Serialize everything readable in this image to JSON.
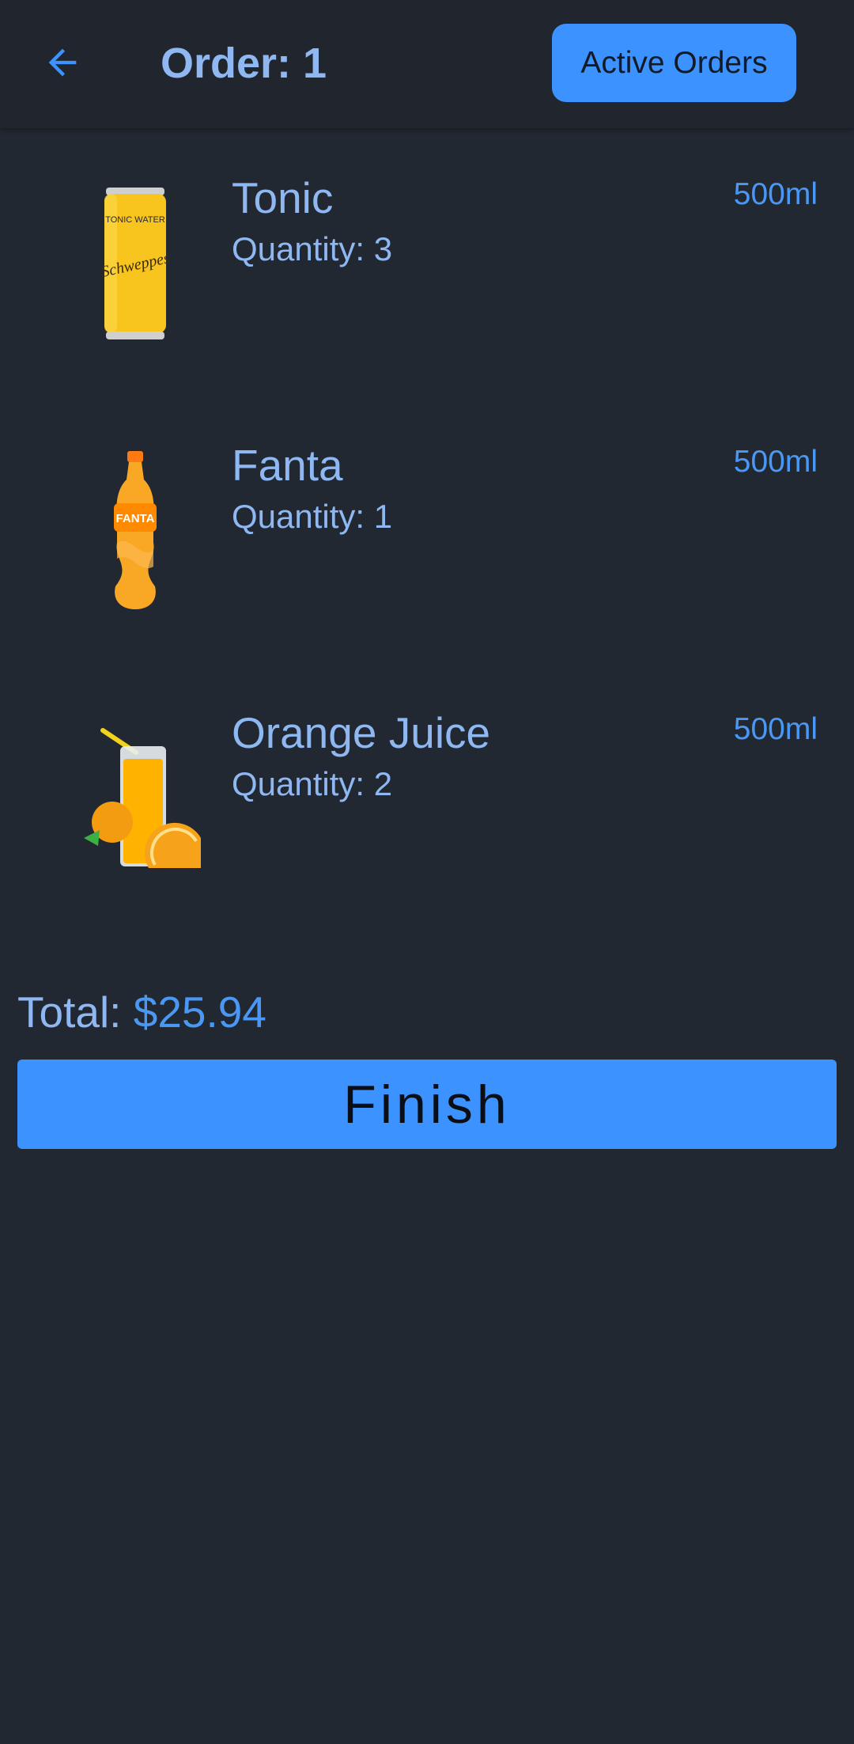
{
  "header": {
    "back_icon": "arrow-left-icon",
    "title": "Order: 1",
    "active_orders_label": "Active Orders"
  },
  "items": [
    {
      "name": "Tonic",
      "quantity": "Quantity: 3",
      "size": "500ml",
      "image_icon": "schweppes-can-image",
      "can_brand": "Schweppes",
      "can_label": "TONIC WATER"
    },
    {
      "name": "Fanta",
      "quantity": "Quantity: 1",
      "size": "500ml",
      "image_icon": "fanta-bottle-image",
      "bottle_brand": "FANTA"
    },
    {
      "name": "Orange Juice",
      "quantity": "Quantity: 2",
      "size": "500ml",
      "image_icon": "orange-juice-glass-image"
    }
  ],
  "summary": {
    "total_label": "Total: ",
    "total_value": "$25.94",
    "finish_label": "Finish"
  },
  "colors": {
    "background": "#222831",
    "accent": "#3c93ff",
    "text_primary": "#8fb8f3",
    "text_accent": "#4a98f5"
  }
}
